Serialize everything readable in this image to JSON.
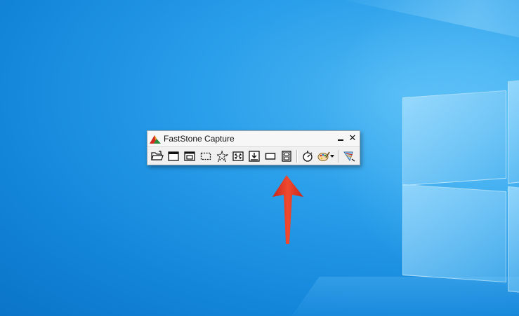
{
  "window": {
    "title": "FastStone Capture",
    "logo_icon": "faststone-logo",
    "controls": [
      {
        "name": "minimize",
        "label": ""
      },
      {
        "name": "close",
        "label": "✕"
      }
    ]
  },
  "toolbar": {
    "tools": [
      {
        "name": "open-file",
        "icon": "open-folder-icon"
      },
      {
        "name": "capture-active-window",
        "icon": "window-icon"
      },
      {
        "name": "capture-window-object",
        "icon": "window-object-icon"
      },
      {
        "name": "capture-rectangular-region",
        "icon": "dashed-rectangle-icon"
      },
      {
        "name": "capture-freehand-region",
        "icon": "freehand-region-icon"
      },
      {
        "name": "capture-full-screen",
        "icon": "full-screen-icon"
      },
      {
        "name": "capture-scrolling-window",
        "icon": "scrolling-window-icon"
      },
      {
        "name": "capture-fixed-region",
        "icon": "fixed-region-icon"
      },
      {
        "name": "screen-recorder",
        "icon": "film-strip-icon"
      },
      {
        "name": "delay-before-capture",
        "icon": "stopwatch-icon"
      },
      {
        "name": "output-options",
        "icon": "palette-icon"
      },
      {
        "name": "settings",
        "icon": "settings-icon"
      }
    ]
  },
  "annotation": {
    "icon": "red-arrow-icon",
    "color": "#e8321f"
  },
  "colors": {
    "desktop": "#1487db",
    "window": "#f0f0f0"
  }
}
